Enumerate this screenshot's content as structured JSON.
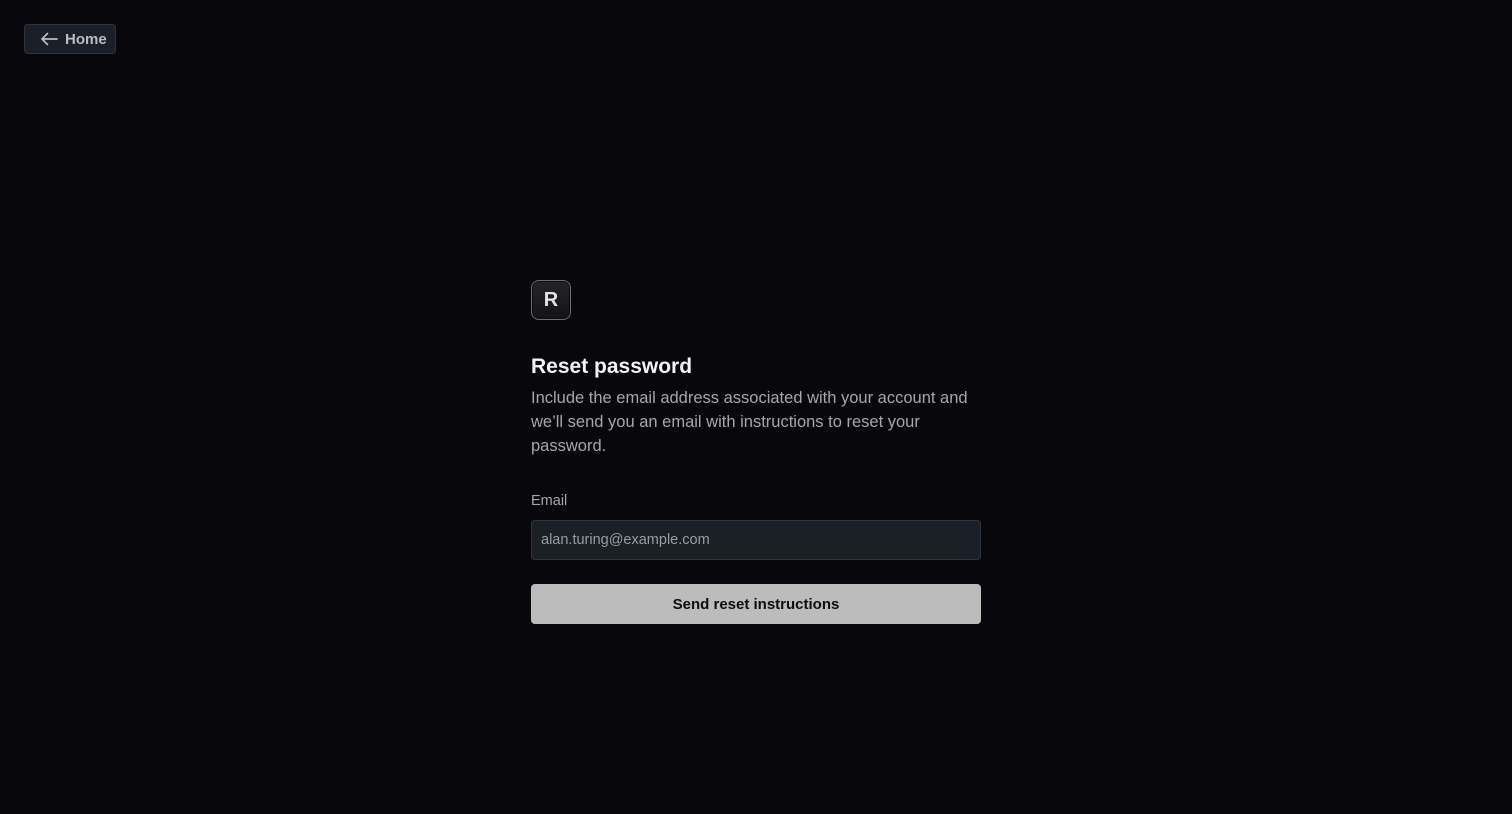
{
  "nav": {
    "home_label": "Home",
    "home_icon": "arrow-left-icon"
  },
  "brand": {
    "logo_letter": "R"
  },
  "form": {
    "title": "Reset password",
    "description": "Include the email address associated with your account and we’ll send you an email with instructions to reset your password.",
    "email_label": "Email",
    "email_placeholder": "alan.turing@example.com",
    "email_value": "",
    "submit_label": "Send reset instructions"
  },
  "colors": {
    "background": "#08080c",
    "button_bg": "#bcbcbd",
    "input_bg": "#1b1f26"
  }
}
